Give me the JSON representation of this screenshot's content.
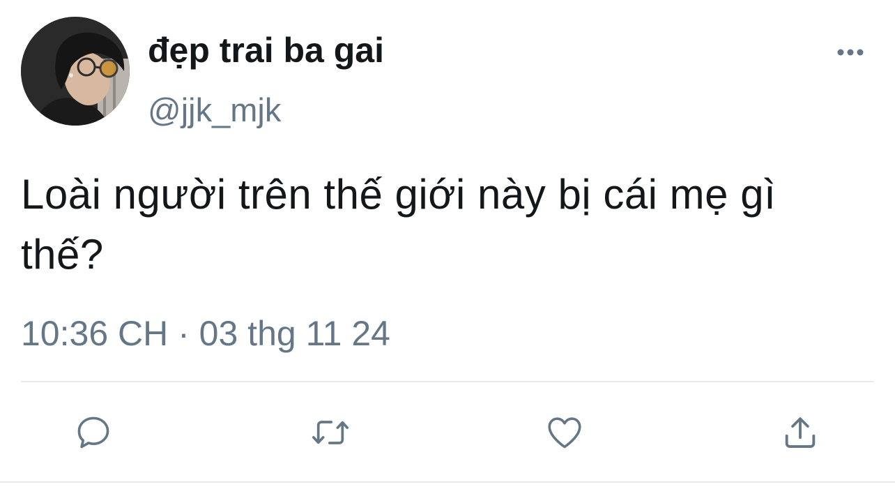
{
  "tweet": {
    "author": {
      "display_name": "đẹp trai ba gai",
      "handle": "@jjk_mjk"
    },
    "text": "Loài người trên thế giới này bị cái mẹ gì thế?",
    "timestamp": "10:36 CH · 03 thg 11 24"
  },
  "icons": {
    "more": "more-horizontal-icon",
    "reply": "reply-icon",
    "retweet": "retweet-icon",
    "like": "heart-icon",
    "share": "share-icon"
  },
  "colors": {
    "text_primary": "#14171a",
    "text_secondary": "#657786",
    "divider": "#e6ecf0"
  }
}
